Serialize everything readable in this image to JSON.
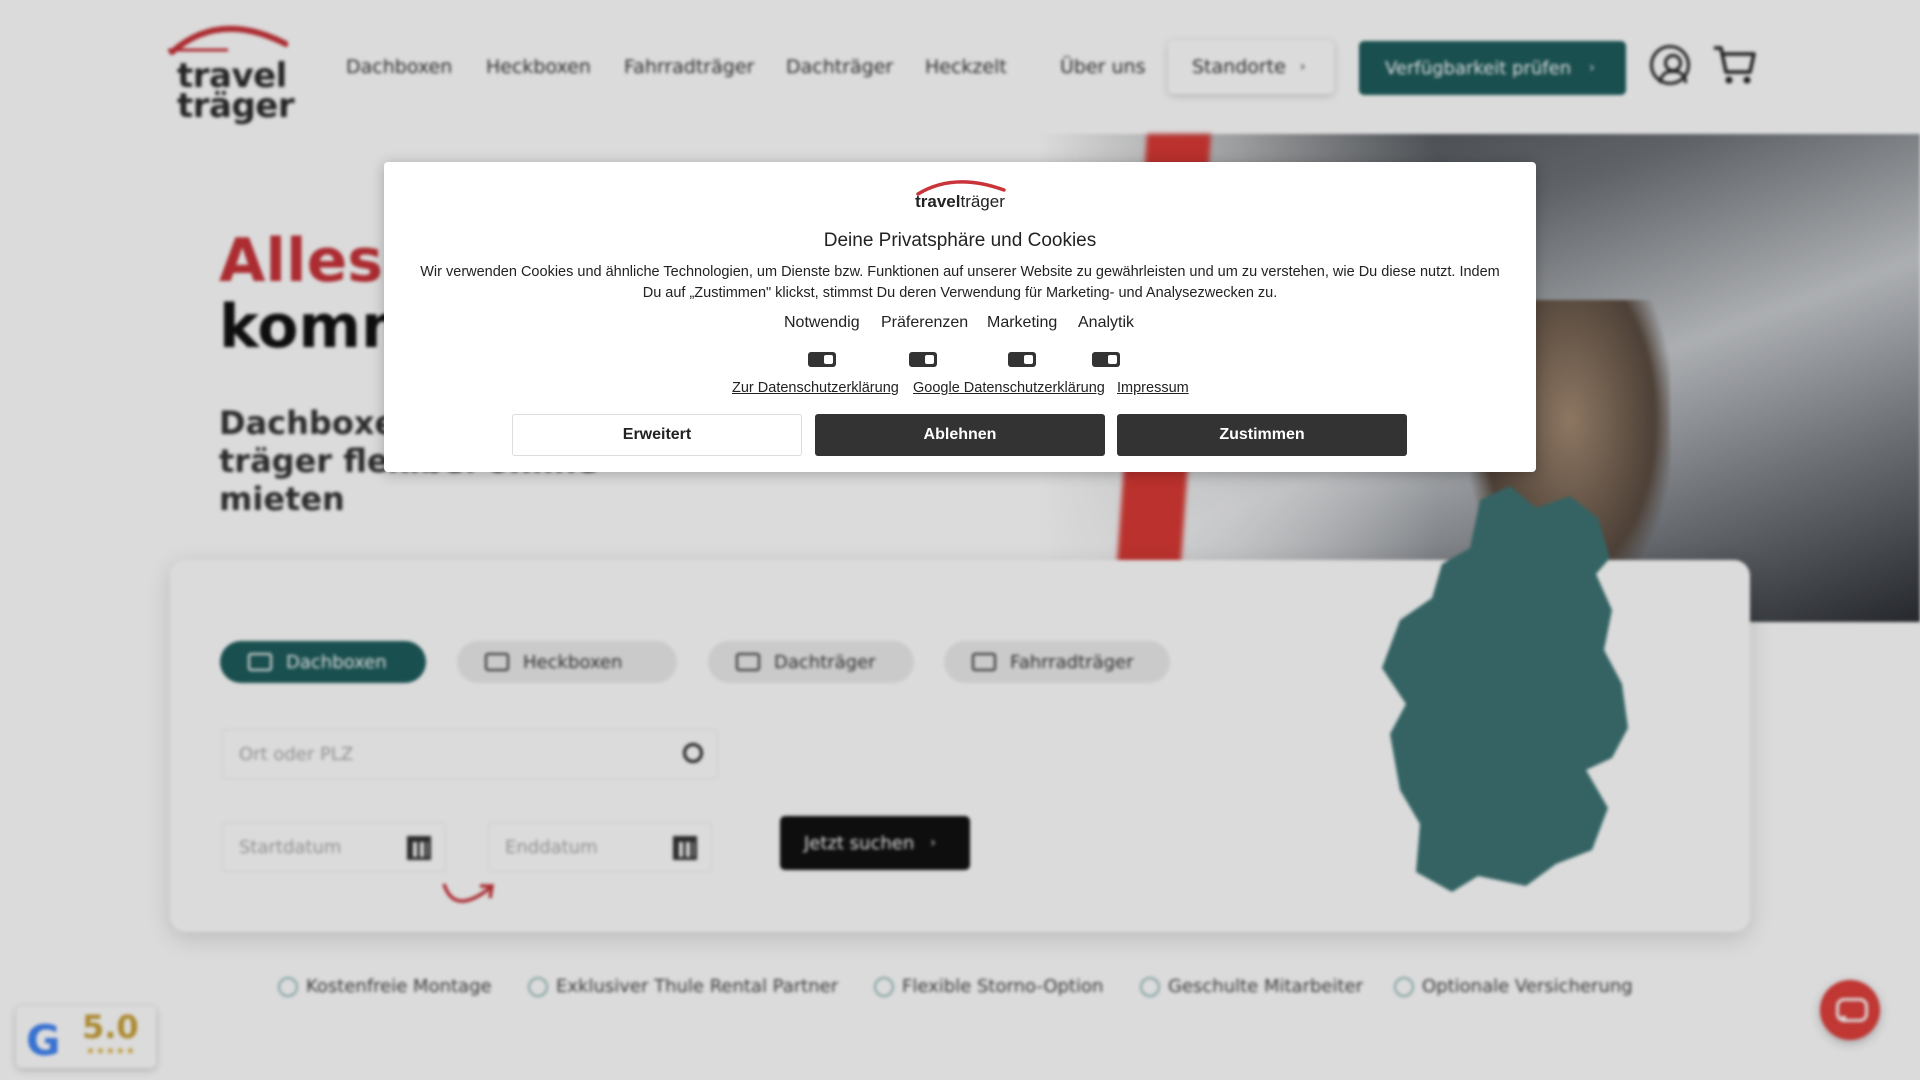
{
  "header": {
    "logo_line1": "travel",
    "logo_line2": "träger",
    "nav": [
      "Dachboxen",
      "Heckboxen",
      "Fahrradträger",
      "Dachträger",
      "Heckzelt",
      "Über uns"
    ],
    "standorte_label": "Standorte",
    "cta_label": "Verfügbarkeit prüfen",
    "accent_color": "#1f5d5d",
    "brand_red": "#c8343a"
  },
  "hero": {
    "title_line1": "Alles",
    "title_line2": "komm",
    "subtitle": "Dachboxen\nträger flexibel online mieten"
  },
  "search": {
    "tabs": [
      "Dachboxen",
      "Heckboxen",
      "Dachträger",
      "Fahrradträger"
    ],
    "active_tab": "Dachboxen",
    "location_placeholder": "Ort oder PLZ",
    "start_placeholder": "Startdatum",
    "end_placeholder": "Enddatum",
    "submit_label": "Jetzt suchen"
  },
  "usps": [
    "Kostenfreie Montage",
    "Exklusiver Thule Rental Partner",
    "Flexible Storno-Option",
    "Geschulte Mitarbeiter",
    "Optionale Versicherung"
  ],
  "google_badge": {
    "score": "5.0",
    "stars": "★★★★★"
  },
  "cookie_dialog": {
    "logo_text_bold": "travel",
    "logo_text_regular": "träger",
    "title": "Deine Privatsphäre und Cookies",
    "text": "Wir verwenden Cookies und ähnliche Technologien, um Dienste bzw. Funktionen auf unserer Website zu gewährleisten und um zu verstehen, wie Du diese nutzt. Indem Du auf „Zustimmen\" klickst, stimmst Du deren Verwendung für Marketing- und Analysezwecken zu.",
    "categories": [
      "Notwendig",
      "Präferenzen",
      "Marketing",
      "Analytik"
    ],
    "links": [
      "Zur Datenschutzerklärung",
      "Google Datenschutzerklärung",
      "Impressum"
    ],
    "buttons": {
      "advanced": "Erweitert",
      "decline": "Ablehnen",
      "accept": "Zustimmen"
    }
  }
}
